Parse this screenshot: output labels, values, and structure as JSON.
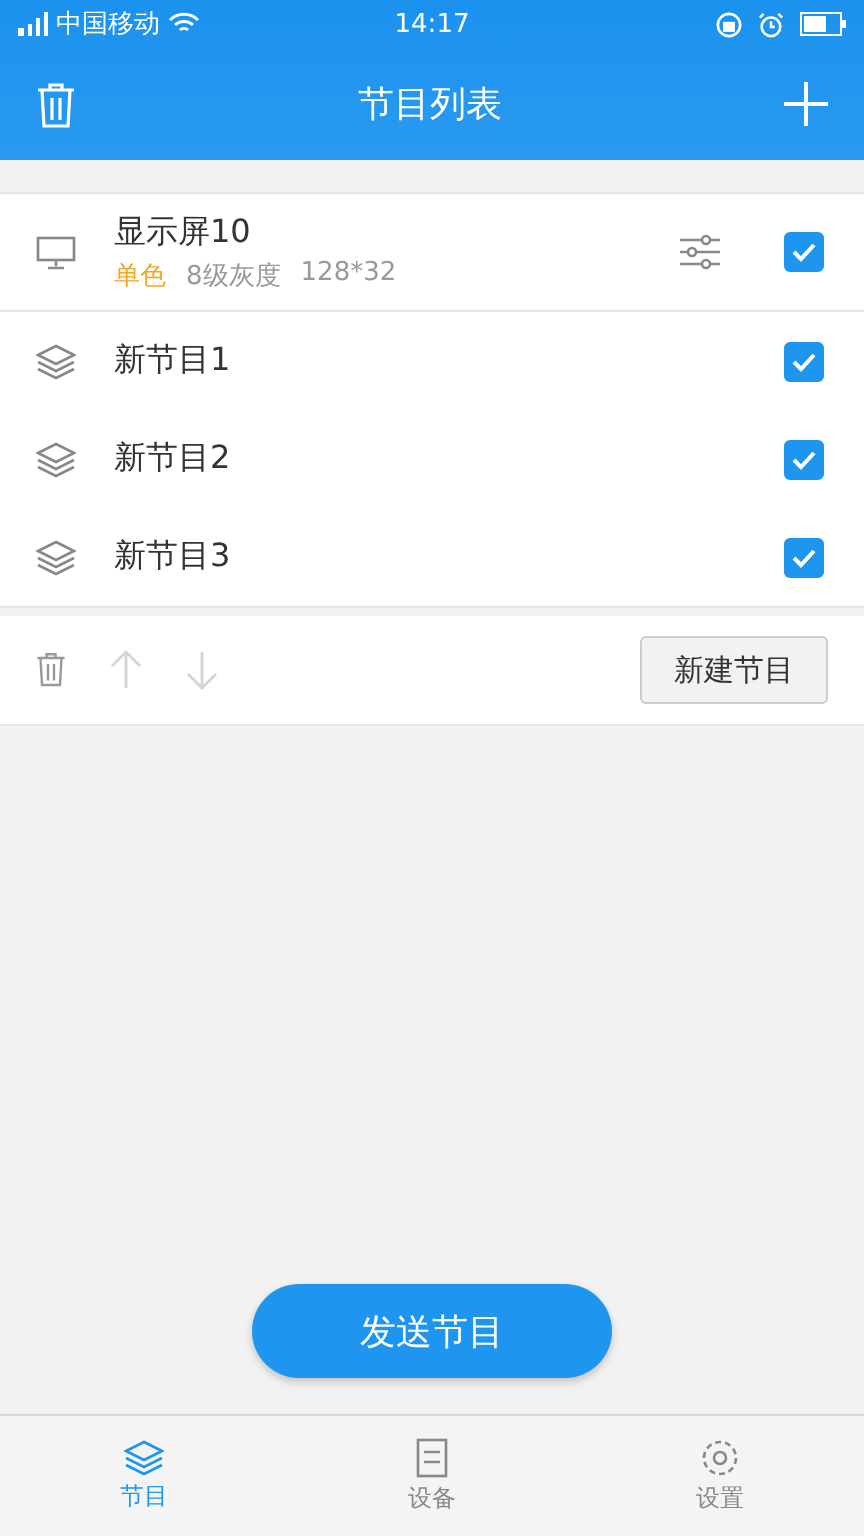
{
  "status_bar": {
    "carrier": "中国移动",
    "time": "14:17"
  },
  "header": {
    "title": "节目列表"
  },
  "display": {
    "name": "显示屏10",
    "color_mode": "单色",
    "gray_level": "8级灰度",
    "resolution": "128*32",
    "checked": true
  },
  "programs": [
    {
      "name": "新节目1",
      "checked": true
    },
    {
      "name": "新节目2",
      "checked": true
    },
    {
      "name": "新节目3",
      "checked": true
    }
  ],
  "toolbar": {
    "actions": [
      {
        "kind": "delete",
        "disabled": false
      },
      {
        "kind": "up",
        "disabled": true
      },
      {
        "kind": "down",
        "disabled": true
      }
    ],
    "new_button": "新建节目"
  },
  "send_button": "发送节目",
  "tabs": [
    {
      "label": "节目",
      "selected": true
    },
    {
      "label": "设备",
      "selected": false
    },
    {
      "label": "设置",
      "selected": false
    }
  ]
}
